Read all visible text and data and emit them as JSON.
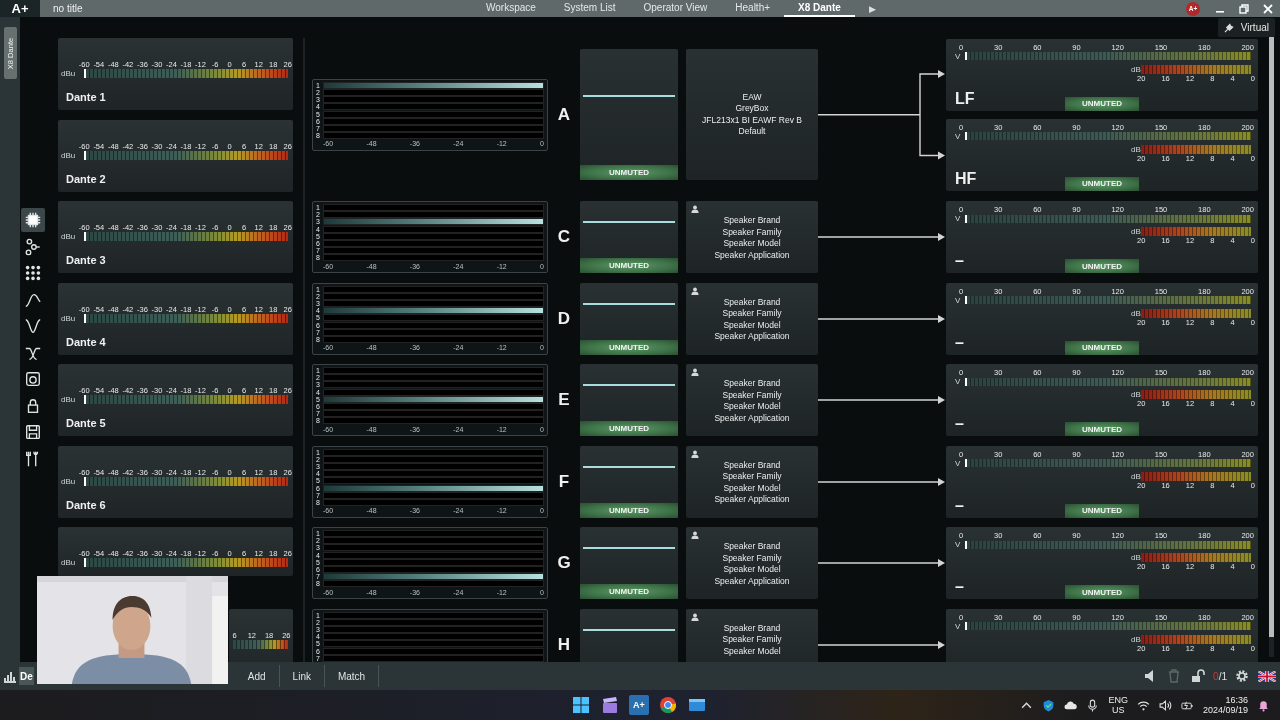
{
  "app_bar": {
    "logo": "A+",
    "title": "no title",
    "tabs": [
      {
        "label": "Workspace",
        "selected": false
      },
      {
        "label": "System List",
        "selected": false
      },
      {
        "label": "Operator View",
        "selected": false
      },
      {
        "label": "Health+",
        "selected": false
      },
      {
        "label": "X8 Dante",
        "selected": true
      }
    ],
    "more": "▶",
    "account": "A+"
  },
  "mode_button": {
    "label": "Virtual"
  },
  "side_tab": {
    "label": "X8 Dante"
  },
  "tools": [
    {
      "kind": "chip",
      "selected": true
    },
    {
      "kind": "nodes",
      "selected": false
    },
    {
      "kind": "grid",
      "selected": false
    },
    {
      "kind": "bell",
      "selected": false
    },
    {
      "kind": "notch",
      "selected": false
    },
    {
      "kind": "crossover",
      "selected": false
    },
    {
      "kind": "speaker",
      "selected": false
    },
    {
      "kind": "lock",
      "selected": false
    },
    {
      "kind": "save",
      "selected": false
    },
    {
      "kind": "tools",
      "selected": false
    }
  ],
  "inputs": [
    {
      "name": "Dante 1",
      "unit": "dBu",
      "scale": [
        "-60",
        "-54",
        "-48",
        "-42",
        "-36",
        "-30",
        "-24",
        "-18",
        "-12",
        "-6",
        "0",
        "6",
        "12",
        "18",
        "26"
      ]
    },
    {
      "name": "Dante 2",
      "unit": "dBu",
      "scale": [
        "-60",
        "-54",
        "-48",
        "-42",
        "-36",
        "-30",
        "-24",
        "-18",
        "-12",
        "-6",
        "0",
        "6",
        "12",
        "18",
        "26"
      ]
    },
    {
      "name": "Dante 3",
      "unit": "dBu",
      "scale": [
        "-60",
        "-54",
        "-48",
        "-42",
        "-36",
        "-30",
        "-24",
        "-18",
        "-12",
        "-6",
        "0",
        "6",
        "12",
        "18",
        "26"
      ]
    },
    {
      "name": "Dante 4",
      "unit": "dBu",
      "scale": [
        "-60",
        "-54",
        "-48",
        "-42",
        "-36",
        "-30",
        "-24",
        "-18",
        "-12",
        "-6",
        "0",
        "6",
        "12",
        "18",
        "26"
      ]
    },
    {
      "name": "Dante 5",
      "unit": "dBu",
      "scale": [
        "-60",
        "-54",
        "-48",
        "-42",
        "-36",
        "-30",
        "-24",
        "-18",
        "-12",
        "-6",
        "0",
        "6",
        "12",
        "18",
        "26"
      ]
    },
    {
      "name": "Dante 6",
      "unit": "dBu",
      "scale": [
        "-60",
        "-54",
        "-48",
        "-42",
        "-36",
        "-30",
        "-24",
        "-18",
        "-12",
        "-6",
        "0",
        "6",
        "12",
        "18",
        "26"
      ]
    },
    {
      "unit": "dBu",
      "scale": [
        "-60",
        "-54",
        "-48",
        "-42",
        "-36",
        "-30",
        "-24",
        "-18",
        "-12",
        "-6",
        "0",
        "6",
        "12",
        "18",
        "26"
      ]
    },
    {
      "scale": [
        "6",
        "12",
        "18",
        "26"
      ]
    }
  ],
  "groups": [
    {
      "letter": "A",
      "matrix": {
        "rows": [
          {
            "label": "1",
            "selected": true
          },
          {
            "label": "2",
            "selected": false
          },
          {
            "label": "3",
            "selected": false
          },
          {
            "label": "4",
            "selected": false
          },
          {
            "label": "5",
            "selected": false
          },
          {
            "label": "6",
            "selected": false
          },
          {
            "label": "7",
            "selected": false
          },
          {
            "label": "8",
            "selected": false
          }
        ],
        "axis": [
          "-60",
          "-48",
          "-36",
          "-24",
          "-12",
          "0"
        ]
      },
      "mute": {
        "label": "UNMUTED",
        "muted": false
      },
      "speaker": {
        "user_icon": false,
        "lines": [
          "EAW",
          "GreyBox",
          "JFL213x1 BI EAWF Rev B",
          "Default"
        ]
      },
      "outputs": [
        {
          "name": "LF",
          "v_unit": "V",
          "v_scale": [
            "0",
            "30",
            "60",
            "90",
            "120",
            "150",
            "180",
            "200"
          ],
          "db_unit": "dB",
          "db_scale": [
            "20",
            "16",
            "12",
            "8",
            "4",
            "0"
          ],
          "mute": {
            "label": "UNMUTED",
            "muted": false
          }
        },
        {
          "name": "HF",
          "v_unit": "V",
          "v_scale": [
            "0",
            "30",
            "60",
            "90",
            "120",
            "150",
            "180",
            "200"
          ],
          "db_unit": "dB",
          "db_scale": [
            "20",
            "16",
            "12",
            "8",
            "4",
            "0"
          ],
          "mute": {
            "label": "UNMUTED",
            "muted": false
          }
        }
      ]
    },
    {
      "letter": "C",
      "matrix": {
        "rows": [
          {
            "label": "1",
            "selected": false
          },
          {
            "label": "2",
            "selected": false
          },
          {
            "label": "3",
            "selected": true
          },
          {
            "label": "4",
            "selected": false
          },
          {
            "label": "5",
            "selected": false
          },
          {
            "label": "6",
            "selected": false
          },
          {
            "label": "7",
            "selected": false
          },
          {
            "label": "8",
            "selected": false
          }
        ],
        "axis": [
          "-60",
          "-48",
          "-36",
          "-24",
          "-12",
          "0"
        ]
      },
      "mute": {
        "label": "UNMUTED",
        "muted": false
      },
      "speaker": {
        "user_icon": true,
        "lines": [
          "Speaker Brand",
          "Speaker Family",
          "Speaker Model",
          "Speaker Application"
        ]
      },
      "outputs": [
        {
          "name": "–",
          "v_unit": "V",
          "v_scale": [
            "0",
            "30",
            "60",
            "90",
            "120",
            "150",
            "180",
            "200"
          ],
          "db_unit": "dB",
          "db_scale": [
            "20",
            "16",
            "12",
            "8",
            "4",
            "0"
          ],
          "mute": {
            "label": "UNMUTED",
            "muted": false
          }
        }
      ]
    },
    {
      "letter": "D",
      "matrix": {
        "rows": [
          {
            "label": "1",
            "selected": false
          },
          {
            "label": "2",
            "selected": false
          },
          {
            "label": "3",
            "selected": false
          },
          {
            "label": "4",
            "selected": true
          },
          {
            "label": "5",
            "selected": false
          },
          {
            "label": "6",
            "selected": false
          },
          {
            "label": "7",
            "selected": false
          },
          {
            "label": "8",
            "selected": false
          }
        ],
        "axis": [
          "-60",
          "-48",
          "-36",
          "-24",
          "-12",
          "0"
        ]
      },
      "mute": {
        "label": "UNMUTED",
        "muted": false
      },
      "speaker": {
        "user_icon": true,
        "lines": [
          "Speaker Brand",
          "Speaker Family",
          "Speaker Model",
          "Speaker Application"
        ]
      },
      "outputs": [
        {
          "name": "–",
          "v_unit": "V",
          "v_scale": [
            "0",
            "30",
            "60",
            "90",
            "120",
            "150",
            "180",
            "200"
          ],
          "db_unit": "dB",
          "db_scale": [
            "20",
            "16",
            "12",
            "8",
            "4",
            "0"
          ],
          "mute": {
            "label": "UNMUTED",
            "muted": false
          }
        }
      ]
    },
    {
      "letter": "E",
      "matrix": {
        "rows": [
          {
            "label": "1",
            "selected": false
          },
          {
            "label": "2",
            "selected": false
          },
          {
            "label": "3",
            "selected": false
          },
          {
            "label": "4",
            "selected": false
          },
          {
            "label": "5",
            "selected": true
          },
          {
            "label": "6",
            "selected": false
          },
          {
            "label": "7",
            "selected": false
          },
          {
            "label": "8",
            "selected": false
          }
        ],
        "axis": [
          "-60",
          "-48",
          "-36",
          "-24",
          "-12",
          "0"
        ]
      },
      "mute": {
        "label": "UNMUTED",
        "muted": false
      },
      "speaker": {
        "user_icon": true,
        "lines": [
          "Speaker Brand",
          "Speaker Family",
          "Speaker Model",
          "Speaker Application"
        ]
      },
      "outputs": [
        {
          "name": "–",
          "v_unit": "V",
          "v_scale": [
            "0",
            "30",
            "60",
            "90",
            "120",
            "150",
            "180",
            "200"
          ],
          "db_unit": "dB",
          "db_scale": [
            "20",
            "16",
            "12",
            "8",
            "4",
            "0"
          ],
          "mute": {
            "label": "UNMUTED",
            "muted": false
          }
        }
      ]
    },
    {
      "letter": "F",
      "matrix": {
        "rows": [
          {
            "label": "1",
            "selected": false
          },
          {
            "label": "2",
            "selected": false
          },
          {
            "label": "3",
            "selected": false
          },
          {
            "label": "4",
            "selected": false
          },
          {
            "label": "5",
            "selected": false
          },
          {
            "label": "6",
            "selected": true
          },
          {
            "label": "7",
            "selected": false
          },
          {
            "label": "8",
            "selected": false
          }
        ],
        "axis": [
          "-60",
          "-48",
          "-36",
          "-24",
          "-12",
          "0"
        ]
      },
      "mute": {
        "label": "UNMUTED",
        "muted": false
      },
      "speaker": {
        "user_icon": true,
        "lines": [
          "Speaker Brand",
          "Speaker Family",
          "Speaker Model",
          "Speaker Application"
        ]
      },
      "outputs": [
        {
          "name": "–",
          "v_unit": "V",
          "v_scale": [
            "0",
            "30",
            "60",
            "90",
            "120",
            "150",
            "180",
            "200"
          ],
          "db_unit": "dB",
          "db_scale": [
            "20",
            "16",
            "12",
            "8",
            "4",
            "0"
          ],
          "mute": {
            "label": "UNMUTED",
            "muted": false
          }
        }
      ]
    },
    {
      "letter": "G",
      "matrix": {
        "rows": [
          {
            "label": "1",
            "selected": false
          },
          {
            "label": "2",
            "selected": false
          },
          {
            "label": "3",
            "selected": false
          },
          {
            "label": "4",
            "selected": false
          },
          {
            "label": "5",
            "selected": false
          },
          {
            "label": "6",
            "selected": false
          },
          {
            "label": "7",
            "selected": true
          },
          {
            "label": "8",
            "selected": false
          }
        ],
        "axis": [
          "-60",
          "-48",
          "-36",
          "-24",
          "-12",
          "0"
        ]
      },
      "mute": {
        "label": "UNMUTED",
        "muted": false
      },
      "speaker": {
        "user_icon": true,
        "lines": [
          "Speaker Brand",
          "Speaker Family",
          "Speaker Model",
          "Speaker Application"
        ]
      },
      "outputs": [
        {
          "name": "–",
          "v_unit": "V",
          "v_scale": [
            "0",
            "30",
            "60",
            "90",
            "120",
            "150",
            "180",
            "200"
          ],
          "db_unit": "dB",
          "db_scale": [
            "20",
            "16",
            "12",
            "8",
            "4",
            "0"
          ],
          "mute": {
            "label": "UNMUTED",
            "muted": false
          }
        }
      ]
    },
    {
      "letter": "H",
      "matrix": {
        "rows": [
          {
            "label": "1",
            "selected": false
          },
          {
            "label": "2",
            "selected": false
          },
          {
            "label": "3",
            "selected": false
          },
          {
            "label": "4",
            "selected": false
          },
          {
            "label": "5",
            "selected": false
          },
          {
            "label": "6",
            "selected": false
          },
          {
            "label": "7",
            "selected": false
          }
        ]
      },
      "speaker": {
        "user_icon": true,
        "lines": [
          "Speaker Brand",
          "Speaker Family",
          "Speaker Model"
        ]
      },
      "outputs": [
        {
          "v_unit": "V",
          "v_scale": [
            "0",
            "30",
            "60",
            "90",
            "120",
            "150",
            "180",
            "200"
          ],
          "db_unit": "dB",
          "db_scale": [
            "20",
            "16",
            "12",
            "8",
            "4",
            "0"
          ]
        }
      ]
    }
  ],
  "toolbar": {
    "tab": {
      "label": "De",
      "selected": true
    },
    "buttons": [
      "Add",
      "Link",
      "Match"
    ],
    "count": "0",
    "total": "/1"
  },
  "taskbar": {
    "app_label": "A+",
    "lang": "ENG",
    "region": "US",
    "time": "16:36",
    "date": "2024/09/19"
  }
}
